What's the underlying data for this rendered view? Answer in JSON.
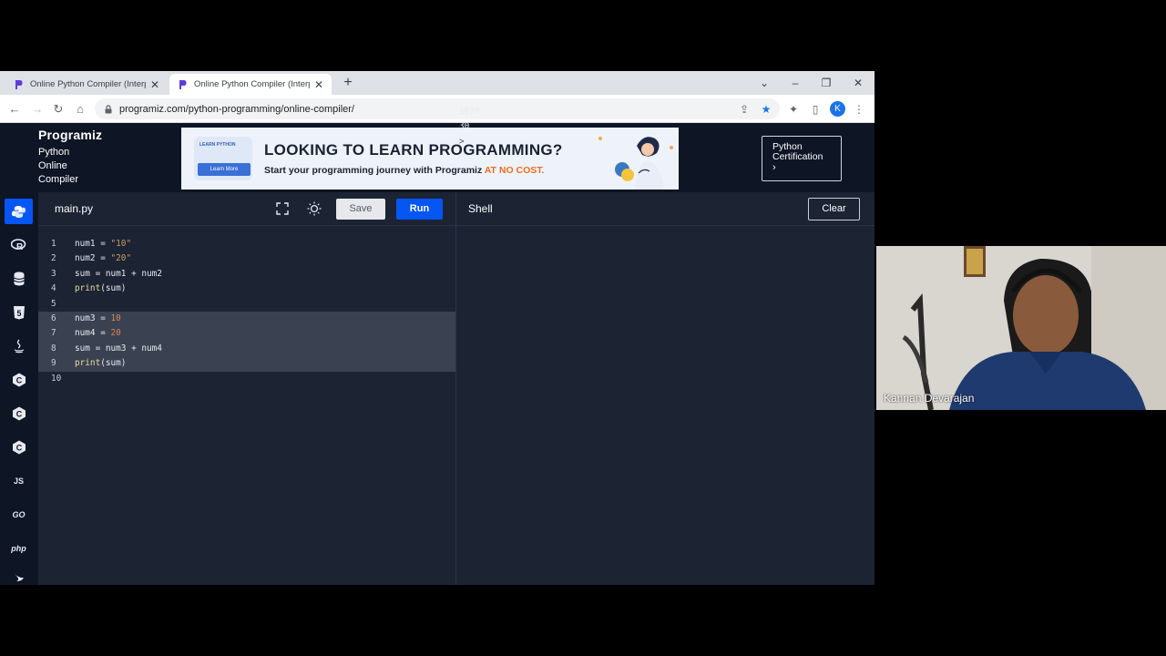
{
  "browser": {
    "tabs": [
      {
        "title": "Online Python Compiler (Interpre",
        "active": false
      },
      {
        "title": "Online Python Compiler (Interpre",
        "active": true
      }
    ],
    "url": "programiz.com/python-programming/online-compiler/",
    "profile_initial": "K",
    "colors": {
      "chrome": "#dee1e6",
      "accent": "#1a73e8"
    }
  },
  "header": {
    "brand": "Programiz",
    "subtitle": [
      "Python",
      "Online",
      "Compiler"
    ],
    "ad": {
      "book_label": "LEARN PYTHON",
      "learn_more": "Learn More",
      "headline": "LOOKING TO LEARN PROGRAMMING?",
      "tagline_prefix": "Start your programming journey with Programiz ",
      "tagline_accent": "AT NO COST."
    },
    "certification": [
      "Python",
      "Certification"
    ]
  },
  "sidebar": {
    "languages": [
      {
        "name": "python",
        "label": "",
        "active": true
      },
      {
        "name": "r",
        "label": "R",
        "active": false
      },
      {
        "name": "sql",
        "label": "",
        "active": false
      },
      {
        "name": "html",
        "label": "5",
        "active": false
      },
      {
        "name": "java",
        "label": "",
        "active": false
      },
      {
        "name": "c",
        "label": "C",
        "active": false
      },
      {
        "name": "cpp",
        "label": "C",
        "active": false
      },
      {
        "name": "csharp",
        "label": "C",
        "active": false
      },
      {
        "name": "js",
        "label": "JS",
        "active": false
      },
      {
        "name": "go",
        "label": "GO",
        "active": false
      },
      {
        "name": "php",
        "label": "php",
        "active": false
      }
    ]
  },
  "editor": {
    "file": "main.py",
    "save_label": "Save",
    "run_label": "Run",
    "lines": [
      {
        "n": "1",
        "parts": [
          [
            "t",
            "num1 = "
          ],
          [
            "s",
            "\"10\""
          ]
        ],
        "selected": false
      },
      {
        "n": "2",
        "parts": [
          [
            "t",
            "num2 = "
          ],
          [
            "s",
            "\"20\""
          ]
        ],
        "selected": false
      },
      {
        "n": "3",
        "parts": [
          [
            "t",
            "sum = num1 + num2"
          ]
        ],
        "selected": false
      },
      {
        "n": "4",
        "parts": [
          [
            "f",
            "print"
          ],
          [
            "t",
            "(sum)"
          ]
        ],
        "selected": false
      },
      {
        "n": "5",
        "parts": [],
        "selected": false
      },
      {
        "n": "6",
        "parts": [
          [
            "t",
            "num3 = "
          ],
          [
            "d",
            "10"
          ]
        ],
        "selected": true
      },
      {
        "n": "7",
        "parts": [
          [
            "t",
            "num4 = "
          ],
          [
            "d",
            "20"
          ]
        ],
        "selected": true
      },
      {
        "n": "8",
        "parts": [
          [
            "t",
            "sum = num3 + num4"
          ]
        ],
        "selected": true
      },
      {
        "n": "9",
        "parts": [
          [
            "f",
            "print"
          ],
          [
            "t",
            "(sum)"
          ]
        ],
        "selected": true
      },
      {
        "n": "10",
        "parts": [],
        "selected": false
      }
    ]
  },
  "shell": {
    "title": "Shell",
    "clear_label": "Clear",
    "output": [
      "1020",
      "30"
    ],
    "prompt": ">"
  },
  "webcam": {
    "participant": "Kannan Devarajan"
  }
}
